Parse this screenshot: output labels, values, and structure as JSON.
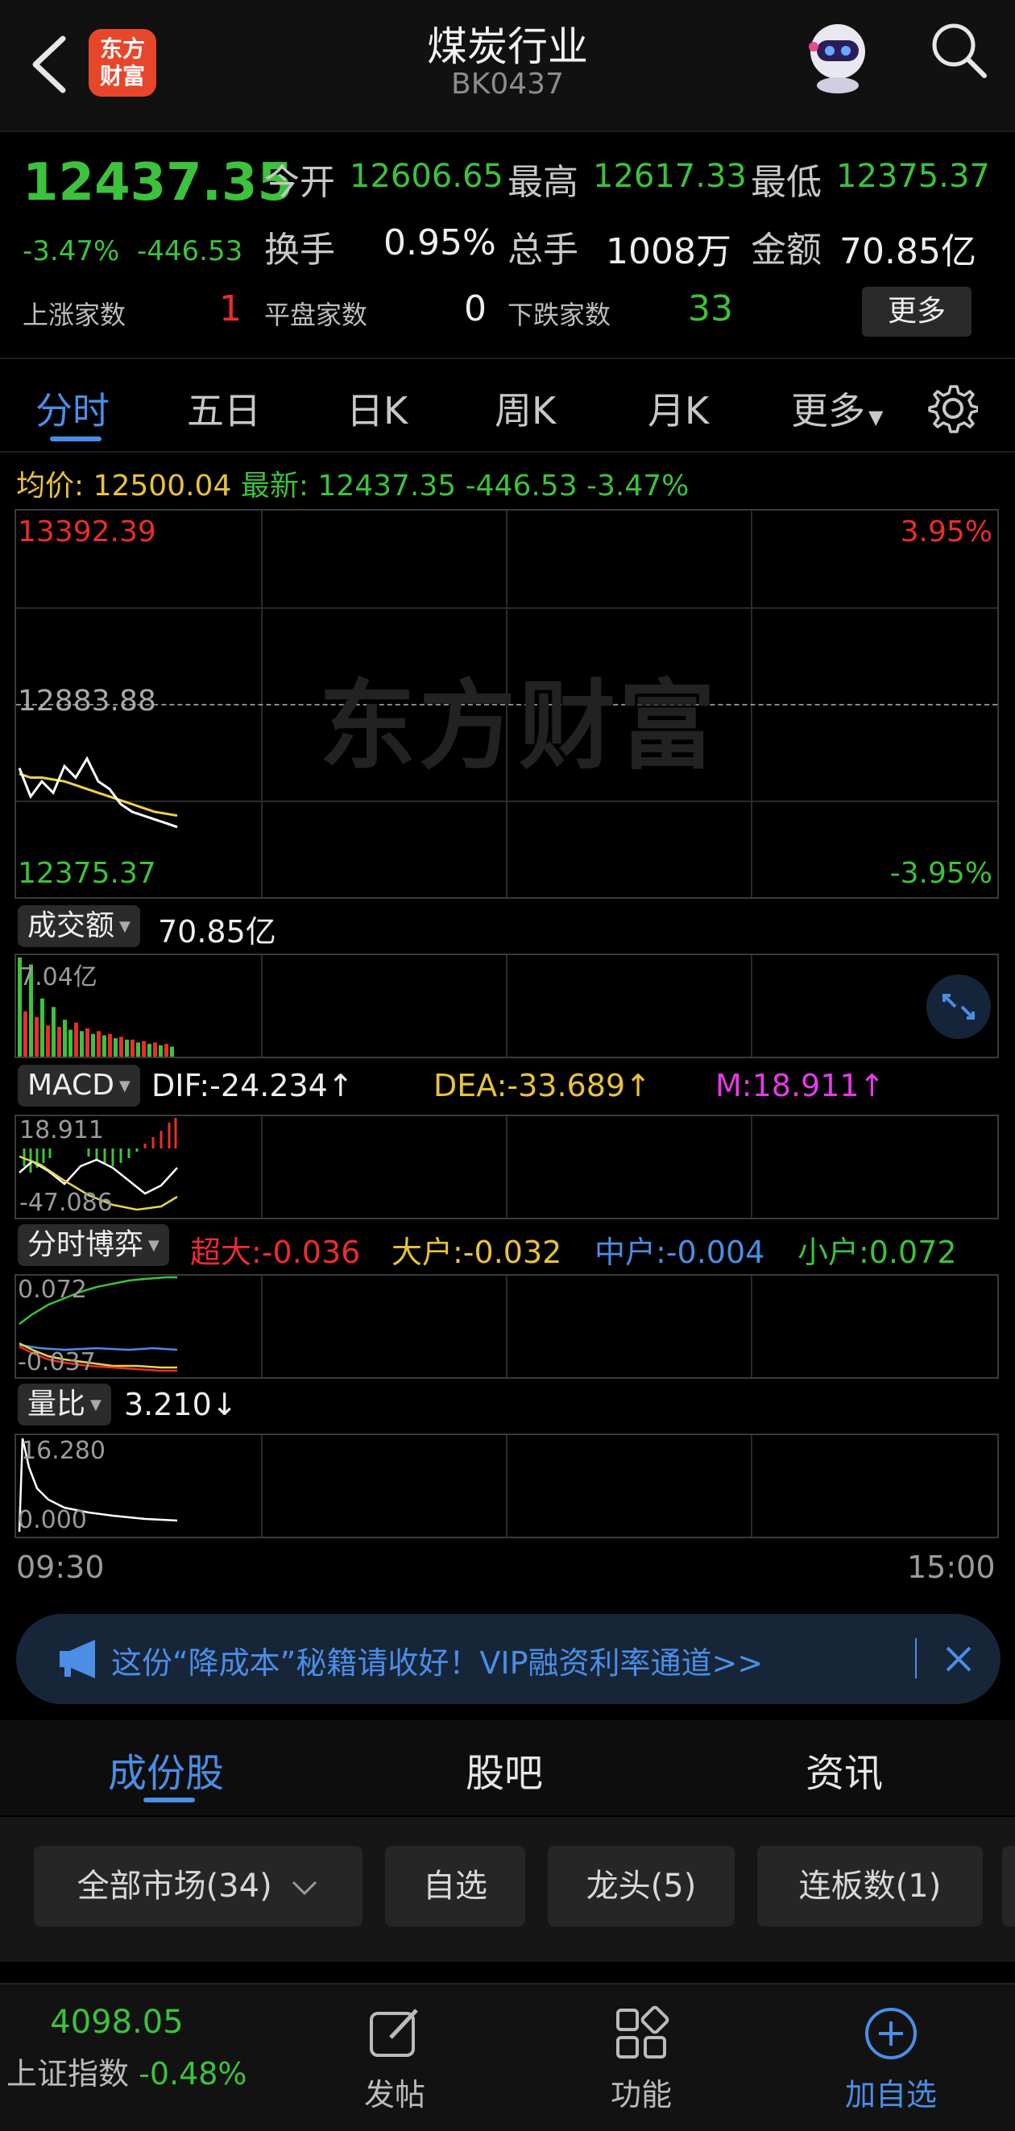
{
  "header": {
    "logo_text_1": "东方",
    "logo_text_2": "财富",
    "title": "煤炭行业",
    "code": "BK0437"
  },
  "quote": {
    "price": "12437.35",
    "change_pct": "-3.47%",
    "change": "-446.53",
    "open_label": "今开",
    "open": "12606.65",
    "high_label": "最高",
    "high": "12617.33",
    "low_label": "最低",
    "low": "12375.37",
    "turnover_label": "换手",
    "turnover": "0.95%",
    "volume_label": "总手",
    "volume": "1008万",
    "amount_label": "金额",
    "amount": "70.85亿",
    "up_label": "上涨家数",
    "up_count": "1",
    "flat_label": "平盘家数",
    "flat_count": "0",
    "down_label": "下跌家数",
    "down_count": "33",
    "more": "更多"
  },
  "tabs": [
    "分时",
    "五日",
    "日K",
    "周K",
    "月K",
    "更多"
  ],
  "intraday": {
    "avg_label": "均价:",
    "avg": "12500.04",
    "latest_label": "最新:",
    "latest": "12437.35 -446.53 -3.47%",
    "y_top": "13392.39",
    "y_mid": "12883.88",
    "y_bottom": "12375.37",
    "pct_top": "3.95%",
    "pct_bottom": "-3.95%",
    "watermark": "东方财富",
    "price_series": [
      12715,
      12640,
      12680,
      12650,
      12720,
      12690,
      12740,
      12680,
      12660,
      12620,
      12600,
      12590,
      12580,
      12570,
      12560
    ],
    "avg_series": [
      12700,
      12690,
      12690,
      12685,
      12680,
      12670,
      12660,
      12650,
      12640,
      12630,
      12620,
      12610,
      12600,
      12595,
      12590
    ],
    "colors": {
      "price": "#ffffff",
      "avg": "#e8d44a",
      "up": "#ec2c2c",
      "down": "#3cc23c"
    }
  },
  "volume_panel": {
    "selector": "成交额",
    "value": "70.85亿",
    "max_label": "7.04亿",
    "bars": [
      7.0,
      3.2,
      6.5,
      2.8,
      4.1,
      2.2,
      3.5,
      2.1,
      2.6,
      1.9,
      2.4,
      1.8,
      2.0,
      1.6,
      1.8,
      1.5,
      1.6,
      1.3,
      1.4,
      1.2,
      1.2,
      1.0,
      1.1,
      0.9,
      1.0,
      0.8,
      0.9,
      0.7
    ],
    "bar_up": [
      false,
      true,
      false,
      true,
      false,
      true,
      false,
      true,
      false,
      false,
      true,
      false,
      true,
      false,
      true,
      false,
      true,
      false,
      true,
      false,
      true,
      false,
      true,
      false,
      true,
      false,
      true,
      false
    ]
  },
  "macd": {
    "selector": "MACD",
    "dif": "DIF:-24.234↑",
    "dea": "DEA:-33.689↑",
    "m": "M:18.911↑",
    "top_label": "18.911",
    "bottom_label": "-47.086"
  },
  "bo_yi": {
    "selector": "分时博弈",
    "super": "超大:-0.036",
    "large": "大户:-0.032",
    "mid": "中户:-0.004",
    "small": "小户:0.072",
    "top_label": "0.072",
    "bottom_label": "-0.037"
  },
  "liang_bi": {
    "selector": "量比",
    "value": "3.210↓",
    "top_label": "16.280",
    "bottom_label": "0.000"
  },
  "time_axis": {
    "start": "09:30",
    "end": "15:00"
  },
  "ad": {
    "text": "这份“降成本”秘籍请收好！VIP融资利率通道>>"
  },
  "sub_tabs": [
    "成份股",
    "股吧",
    "资讯"
  ],
  "filters": [
    "全部市场(34)",
    "自选",
    "龙头(5)",
    "连板数(1)"
  ],
  "bottom_bar": {
    "index_value": "4098.05",
    "index_name": "上证指数",
    "index_change": "-0.48%",
    "items": [
      "发帖",
      "功能",
      "加自选"
    ]
  }
}
